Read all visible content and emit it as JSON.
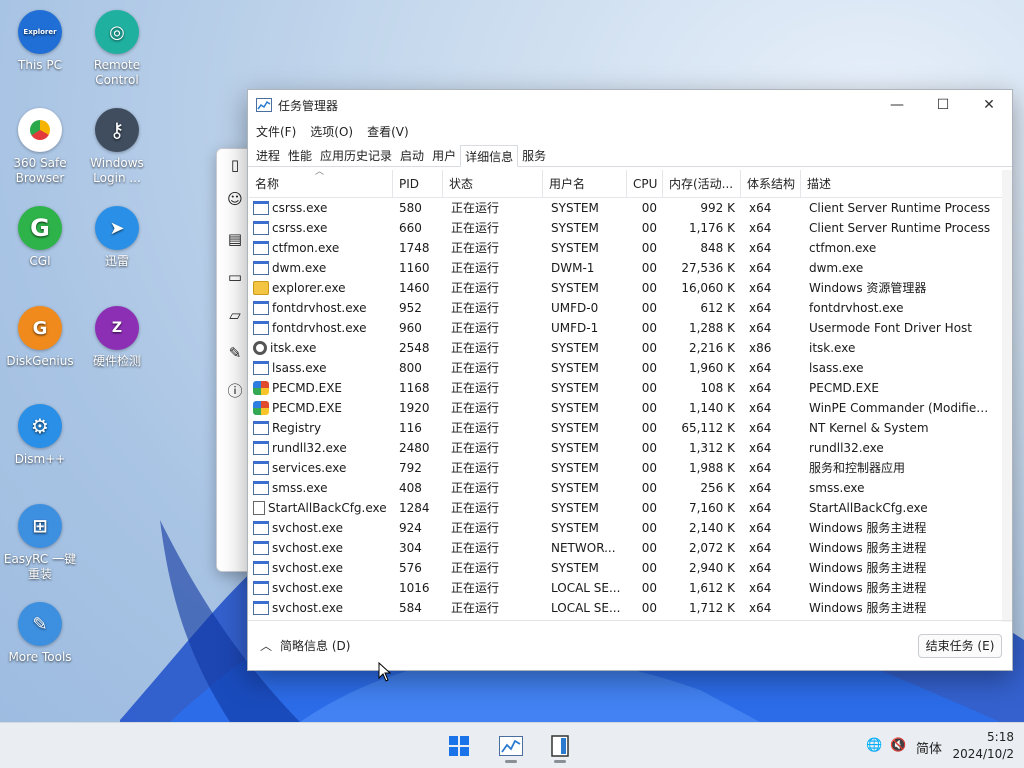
{
  "desktop": {
    "icons": [
      {
        "label": "This PC",
        "badge": "Explorer",
        "color": "#1f6fd6"
      },
      {
        "label": "Remote Control",
        "color": "#1fb0a0"
      },
      {
        "label": "360 Safe Browser",
        "color": "#ffffff"
      },
      {
        "label": "Windows Login ...",
        "color": "#3f4d5e"
      },
      {
        "label": "CGI",
        "badge": "G",
        "color": "#2db34a"
      },
      {
        "label": "迅雷",
        "color": "#2a8fe6"
      },
      {
        "label": "DiskGenius",
        "badge": "G",
        "color": "#f08a1c"
      },
      {
        "label": "硬件检测",
        "badge": "Z",
        "color": "#8c2fb5"
      },
      {
        "label": "Dism++",
        "color": "#2a8fe6"
      },
      {
        "label": "EasyRC 一键重装",
        "color": "#3d8fe0"
      },
      {
        "label": "More Tools",
        "color": "#3d8fe0"
      }
    ]
  },
  "task_manager": {
    "title": "任务管理器",
    "menu": [
      "文件(F)",
      "选项(O)",
      "查看(V)"
    ],
    "tabs": [
      "进程",
      "性能",
      "应用历史记录",
      "启动",
      "用户",
      "详细信息",
      "服务"
    ],
    "active_tab": "详细信息",
    "columns": [
      "名称",
      "PID",
      "状态",
      "用户名",
      "CPU",
      "内存(活动...",
      "体系结构",
      "描述"
    ],
    "rows": [
      {
        "icon": "win",
        "name": "csrss.exe",
        "pid": "580",
        "status": "正在运行",
        "user": "SYSTEM",
        "cpu": "00",
        "mem": "992 K",
        "arch": "x64",
        "desc": "Client Server Runtime Process"
      },
      {
        "icon": "win",
        "name": "csrss.exe",
        "pid": "660",
        "status": "正在运行",
        "user": "SYSTEM",
        "cpu": "00",
        "mem": "1,176 K",
        "arch": "x64",
        "desc": "Client Server Runtime Process"
      },
      {
        "icon": "win",
        "name": "ctfmon.exe",
        "pid": "1748",
        "status": "正在运行",
        "user": "SYSTEM",
        "cpu": "00",
        "mem": "848 K",
        "arch": "x64",
        "desc": "ctfmon.exe"
      },
      {
        "icon": "win",
        "name": "dwm.exe",
        "pid": "1160",
        "status": "正在运行",
        "user": "DWM-1",
        "cpu": "00",
        "mem": "27,536 K",
        "arch": "x64",
        "desc": "dwm.exe"
      },
      {
        "icon": "folder",
        "name": "explorer.exe",
        "pid": "1460",
        "status": "正在运行",
        "user": "SYSTEM",
        "cpu": "00",
        "mem": "16,060 K",
        "arch": "x64",
        "desc": "Windows 资源管理器"
      },
      {
        "icon": "win",
        "name": "fontdrvhost.exe",
        "pid": "952",
        "status": "正在运行",
        "user": "UMFD-0",
        "cpu": "00",
        "mem": "612 K",
        "arch": "x64",
        "desc": "fontdrvhost.exe"
      },
      {
        "icon": "win",
        "name": "fontdrvhost.exe",
        "pid": "960",
        "status": "正在运行",
        "user": "UMFD-1",
        "cpu": "00",
        "mem": "1,288 K",
        "arch": "x64",
        "desc": "Usermode Font Driver Host"
      },
      {
        "icon": "gear",
        "name": "itsk.exe",
        "pid": "2548",
        "status": "正在运行",
        "user": "SYSTEM",
        "cpu": "00",
        "mem": "2,216 K",
        "arch": "x86",
        "desc": "itsk.exe"
      },
      {
        "icon": "win",
        "name": "lsass.exe",
        "pid": "800",
        "status": "正在运行",
        "user": "SYSTEM",
        "cpu": "00",
        "mem": "1,960 K",
        "arch": "x64",
        "desc": "lsass.exe"
      },
      {
        "icon": "pe",
        "name": "PECMD.EXE",
        "pid": "1168",
        "status": "正在运行",
        "user": "SYSTEM",
        "cpu": "00",
        "mem": "108 K",
        "arch": "x64",
        "desc": "PECMD.EXE"
      },
      {
        "icon": "pe",
        "name": "PECMD.EXE",
        "pid": "1920",
        "status": "正在运行",
        "user": "SYSTEM",
        "cpu": "00",
        "mem": "1,140 K",
        "arch": "x64",
        "desc": "WinPE Commander (Modified ..."
      },
      {
        "icon": "win",
        "name": "Registry",
        "pid": "116",
        "status": "正在运行",
        "user": "SYSTEM",
        "cpu": "00",
        "mem": "65,112 K",
        "arch": "x64",
        "desc": "NT Kernel & System"
      },
      {
        "icon": "win",
        "name": "rundll32.exe",
        "pid": "2480",
        "status": "正在运行",
        "user": "SYSTEM",
        "cpu": "00",
        "mem": "1,312 K",
        "arch": "x64",
        "desc": "rundll32.exe"
      },
      {
        "icon": "win",
        "name": "services.exe",
        "pid": "792",
        "status": "正在运行",
        "user": "SYSTEM",
        "cpu": "00",
        "mem": "1,988 K",
        "arch": "x64",
        "desc": "服务和控制器应用"
      },
      {
        "icon": "win",
        "name": "smss.exe",
        "pid": "408",
        "status": "正在运行",
        "user": "SYSTEM",
        "cpu": "00",
        "mem": "256 K",
        "arch": "x64",
        "desc": "smss.exe"
      },
      {
        "icon": "doc",
        "name": "StartAllBackCfg.exe",
        "pid": "1284",
        "status": "正在运行",
        "user": "SYSTEM",
        "cpu": "00",
        "mem": "7,160 K",
        "arch": "x64",
        "desc": "StartAllBackCfg.exe"
      },
      {
        "icon": "win",
        "name": "svchost.exe",
        "pid": "924",
        "status": "正在运行",
        "user": "SYSTEM",
        "cpu": "00",
        "mem": "2,140 K",
        "arch": "x64",
        "desc": "Windows 服务主进程"
      },
      {
        "icon": "win",
        "name": "svchost.exe",
        "pid": "304",
        "status": "正在运行",
        "user": "NETWOR...",
        "cpu": "00",
        "mem": "2,072 K",
        "arch": "x64",
        "desc": "Windows 服务主进程"
      },
      {
        "icon": "win",
        "name": "svchost.exe",
        "pid": "576",
        "status": "正在运行",
        "user": "SYSTEM",
        "cpu": "00",
        "mem": "2,940 K",
        "arch": "x64",
        "desc": "Windows 服务主进程"
      },
      {
        "icon": "win",
        "name": "svchost.exe",
        "pid": "1016",
        "status": "正在运行",
        "user": "LOCAL SE...",
        "cpu": "00",
        "mem": "1,612 K",
        "arch": "x64",
        "desc": "Windows 服务主进程"
      },
      {
        "icon": "win",
        "name": "svchost.exe",
        "pid": "584",
        "status": "正在运行",
        "user": "LOCAL SE...",
        "cpu": "00",
        "mem": "1,712 K",
        "arch": "x64",
        "desc": "Windows 服务主进程"
      }
    ],
    "footer": {
      "brief_label": "简略信息 (D)",
      "end_task_label": "结束任务 (E)"
    }
  },
  "taskbar": {
    "ime": "简体",
    "time": "5:18",
    "date": "2024/10/2"
  }
}
